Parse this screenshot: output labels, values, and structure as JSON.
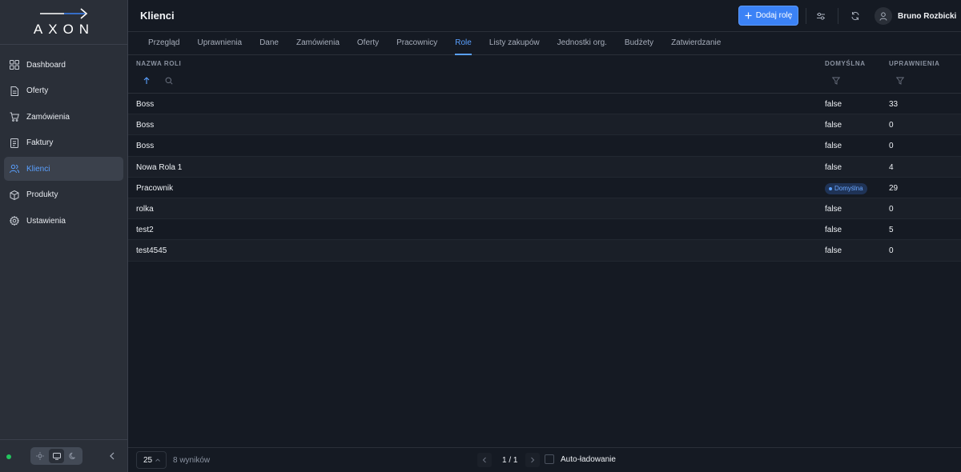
{
  "app": {
    "logo_text": "AXON",
    "page_title": "Klienci"
  },
  "sidebar": {
    "items": [
      {
        "label": "Dashboard",
        "icon": "grid-icon",
        "active": false
      },
      {
        "label": "Oferty",
        "icon": "document-icon",
        "active": false
      },
      {
        "label": "Zamówienia",
        "icon": "cart-icon",
        "active": false
      },
      {
        "label": "Faktury",
        "icon": "invoice-icon",
        "active": false
      },
      {
        "label": "Klienci",
        "icon": "users-icon",
        "active": true
      },
      {
        "label": "Produkty",
        "icon": "box-icon",
        "active": false
      },
      {
        "label": "Ustawienia",
        "icon": "gear-icon",
        "active": false
      }
    ],
    "theme_options": [
      "sun-icon",
      "monitor-icon",
      "moon-icon"
    ],
    "theme_selected": "monitor-icon",
    "status_color": "#22c55e"
  },
  "toolbar": {
    "add_label": "Dodaj rolę",
    "user_name": "Bruno Rozbicki"
  },
  "tabs": [
    {
      "label": "Przegląd",
      "active": false
    },
    {
      "label": "Uprawnienia",
      "active": false
    },
    {
      "label": "Dane",
      "active": false
    },
    {
      "label": "Zamówienia",
      "active": false
    },
    {
      "label": "Oferty",
      "active": false
    },
    {
      "label": "Pracownicy",
      "active": false
    },
    {
      "label": "Role",
      "active": true
    },
    {
      "label": "Listy zakupów",
      "active": false
    },
    {
      "label": "Jednostki org.",
      "active": false
    },
    {
      "label": "Budżety",
      "active": false
    },
    {
      "label": "Zatwierdzanie",
      "active": false
    }
  ],
  "table": {
    "columns": {
      "name": "NAZWA ROLI",
      "default": "DOMYŚLNA",
      "permissions": "UPRAWNIENIA"
    },
    "rows": [
      {
        "name": "Boss",
        "default": "false",
        "permissions": "33"
      },
      {
        "name": "Boss",
        "default": "false",
        "permissions": "0"
      },
      {
        "name": "Boss",
        "default": "false",
        "permissions": "0"
      },
      {
        "name": "Nowa Rola 1",
        "default": "false",
        "permissions": "4"
      },
      {
        "name": "Pracownik",
        "default": "Domyślna",
        "default_badge": true,
        "permissions": "29"
      },
      {
        "name": "rolka",
        "default": "false",
        "permissions": "0"
      },
      {
        "name": "test2",
        "default": "false",
        "permissions": "5"
      },
      {
        "name": "test4545",
        "default": "false",
        "permissions": "0"
      }
    ]
  },
  "footer": {
    "page_size": "25",
    "results": "8 wyników",
    "pager": "1 / 1",
    "autoload_label": "Auto-ładowanie"
  },
  "colors": {
    "accent": "#3b82f6",
    "active_text": "#5aa0ff",
    "background": "#151a23",
    "sidebar": "#2a2f38"
  }
}
